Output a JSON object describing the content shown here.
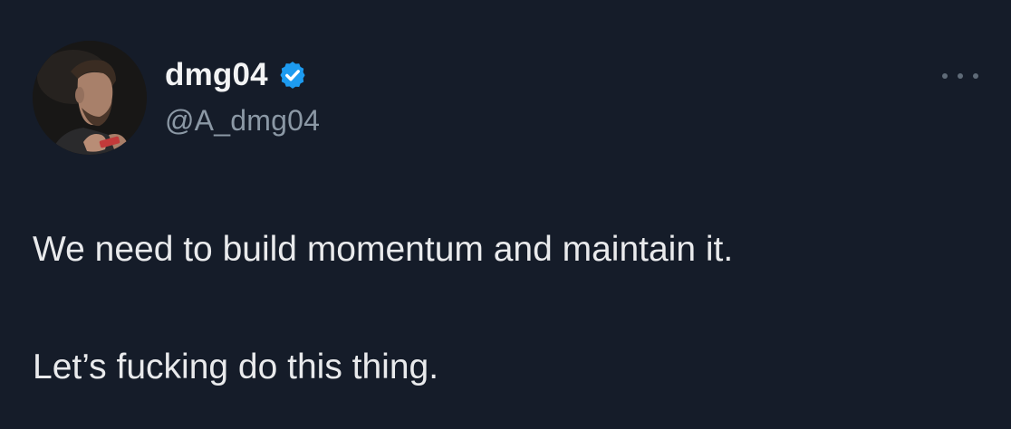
{
  "tweet": {
    "author": {
      "display_name": "dmg04",
      "handle": "@A_dmg04",
      "verified": true,
      "avatar_icon": "profile-photo"
    },
    "more_icon": "more-dots-icon",
    "text_lines": [
      "We need to build momentum and maintain it.",
      "Let’s fucking do this thing."
    ]
  },
  "colors": {
    "background": "#151c29",
    "text": "#e7e9ea",
    "secondary_text": "#8b98a5",
    "verified_badge": "#1d9bf0"
  }
}
